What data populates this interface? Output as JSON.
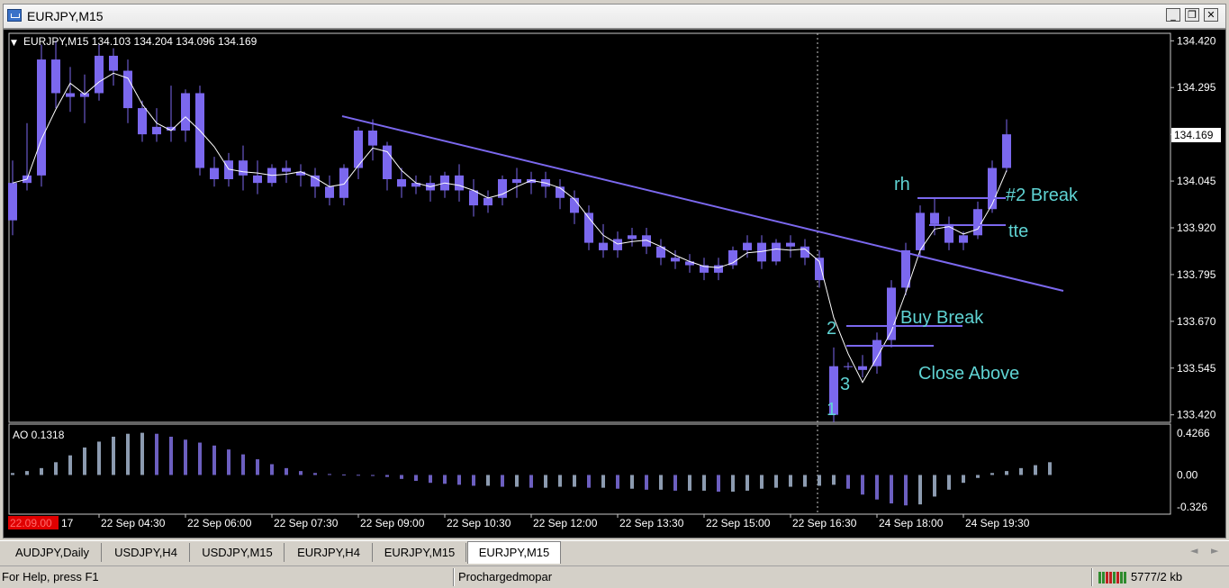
{
  "window": {
    "title": "EURJPY,M15",
    "minimize_glyph": "_",
    "restore_glyph": "❐",
    "close_glyph": "✕"
  },
  "chart": {
    "header_arrow": "▼",
    "header_text": "EURJPY,M15  134.103 134.204 134.096 134.169",
    "indicator_label": "AO 0.1318",
    "current_price_label": "134.169",
    "red_time_label": "22.09.00",
    "first_time_tail": "17",
    "annotations": {
      "rh": "rh",
      "break2": "#2 Break",
      "tte": "tte",
      "buy_break": "Buy Break",
      "close_above": "Close Above",
      "n1": "1",
      "n2": "2",
      "n3": "3"
    },
    "colors": {
      "background": "#000000",
      "candle": "#7b68ee",
      "trend": "#7b68ee",
      "ma": "#ffffff",
      "annotation": "#5fd3d3",
      "axis_text": "#c0c0c0",
      "ao_up": "#8c9bb0",
      "ao_down": "#6c5fc0"
    }
  },
  "chart_data": {
    "type": "candlestick",
    "symbol": "EURJPY",
    "timeframe": "M15",
    "price_ticks": [
      "134.420",
      "134.295",
      "134.170",
      "134.045",
      "133.920",
      "133.795",
      "133.670",
      "133.545",
      "133.420"
    ],
    "price_tick_values": [
      134.42,
      134.295,
      134.17,
      134.045,
      133.92,
      133.795,
      133.67,
      133.545,
      133.42
    ],
    "ylim": [
      133.4,
      134.44
    ],
    "ao_ticks": [
      "0.4266",
      "0.00",
      "-0.326"
    ],
    "ao_tick_values": [
      0.4266,
      0.0,
      -0.326
    ],
    "time_ticks": [
      "22 Sep 04:30",
      "22 Sep 06:00",
      "22 Sep 07:30",
      "22 Sep 09:00",
      "22 Sep 10:30",
      "22 Sep 12:00",
      "22 Sep 13:30",
      "22 Sep 15:00",
      "22 Sep 16:30",
      "24 Sep 18:00",
      "24 Sep 19:30"
    ],
    "last_close": 134.169,
    "candles": [
      {
        "o": 133.94,
        "h": 134.1,
        "c": 134.04,
        "l": 133.9
      },
      {
        "o": 134.04,
        "h": 134.2,
        "c": 134.06,
        "l": 134.02
      },
      {
        "o": 134.06,
        "h": 134.41,
        "c": 134.37,
        "l": 134.03
      },
      {
        "o": 134.37,
        "h": 134.42,
        "c": 134.28,
        "l": 134.24
      },
      {
        "o": 134.28,
        "h": 134.35,
        "c": 134.27,
        "l": 134.23
      },
      {
        "o": 134.27,
        "h": 134.33,
        "c": 134.28,
        "l": 134.2
      },
      {
        "o": 134.28,
        "h": 134.41,
        "c": 134.38,
        "l": 134.26
      },
      {
        "o": 134.38,
        "h": 134.4,
        "c": 134.34,
        "l": 134.3
      },
      {
        "o": 134.34,
        "h": 134.37,
        "c": 134.24,
        "l": 134.2
      },
      {
        "o": 134.24,
        "h": 134.26,
        "c": 134.17,
        "l": 134.15
      },
      {
        "o": 134.17,
        "h": 134.24,
        "c": 134.19,
        "l": 134.15
      },
      {
        "o": 134.19,
        "h": 134.3,
        "c": 134.18,
        "l": 134.15
      },
      {
        "o": 134.18,
        "h": 134.29,
        "c": 134.28,
        "l": 134.15
      },
      {
        "o": 134.28,
        "h": 134.3,
        "c": 134.08,
        "l": 134.06
      },
      {
        "o": 134.08,
        "h": 134.11,
        "c": 134.05,
        "l": 134.03
      },
      {
        "o": 134.05,
        "h": 134.12,
        "c": 134.1,
        "l": 134.03
      },
      {
        "o": 134.1,
        "h": 134.14,
        "c": 134.06,
        "l": 134.02
      },
      {
        "o": 134.06,
        "h": 134.1,
        "c": 134.04,
        "l": 134.01
      },
      {
        "o": 134.04,
        "h": 134.09,
        "c": 134.08,
        "l": 134.03
      },
      {
        "o": 134.08,
        "h": 134.1,
        "c": 134.07,
        "l": 134.04
      },
      {
        "o": 134.07,
        "h": 134.09,
        "c": 134.06,
        "l": 134.03
      },
      {
        "o": 134.06,
        "h": 134.08,
        "c": 134.03,
        "l": 134.0
      },
      {
        "o": 134.03,
        "h": 134.06,
        "c": 134.0,
        "l": 133.98
      },
      {
        "o": 134.0,
        "h": 134.09,
        "c": 134.08,
        "l": 133.98
      },
      {
        "o": 134.08,
        "h": 134.19,
        "c": 134.18,
        "l": 134.05
      },
      {
        "o": 134.18,
        "h": 134.21,
        "c": 134.14,
        "l": 134.1
      },
      {
        "o": 134.14,
        "h": 134.15,
        "c": 134.05,
        "l": 134.02
      },
      {
        "o": 134.05,
        "h": 134.08,
        "c": 134.03,
        "l": 134.0
      },
      {
        "o": 134.03,
        "h": 134.06,
        "c": 134.04,
        "l": 134.01
      },
      {
        "o": 134.04,
        "h": 134.06,
        "c": 134.02,
        "l": 133.99
      },
      {
        "o": 134.02,
        "h": 134.07,
        "c": 134.06,
        "l": 134.0
      },
      {
        "o": 134.06,
        "h": 134.09,
        "c": 134.02,
        "l": 133.99
      },
      {
        "o": 134.02,
        "h": 134.05,
        "c": 133.98,
        "l": 133.95
      },
      {
        "o": 133.98,
        "h": 134.02,
        "c": 134.0,
        "l": 133.96
      },
      {
        "o": 134.0,
        "h": 134.06,
        "c": 134.05,
        "l": 133.98
      },
      {
        "o": 134.05,
        "h": 134.08,
        "c": 134.04,
        "l": 134.0
      },
      {
        "o": 134.04,
        "h": 134.07,
        "c": 134.05,
        "l": 134.01
      },
      {
        "o": 134.05,
        "h": 134.07,
        "c": 134.03,
        "l": 134.0
      },
      {
        "o": 134.03,
        "h": 134.05,
        "c": 134.0,
        "l": 133.97
      },
      {
        "o": 134.0,
        "h": 134.02,
        "c": 133.96,
        "l": 133.93
      },
      {
        "o": 133.96,
        "h": 133.98,
        "c": 133.88,
        "l": 133.86
      },
      {
        "o": 133.88,
        "h": 133.93,
        "c": 133.86,
        "l": 133.84
      },
      {
        "o": 133.86,
        "h": 133.91,
        "c": 133.89,
        "l": 133.84
      },
      {
        "o": 133.89,
        "h": 133.92,
        "c": 133.9,
        "l": 133.87
      },
      {
        "o": 133.9,
        "h": 133.92,
        "c": 133.87,
        "l": 133.85
      },
      {
        "o": 133.87,
        "h": 133.89,
        "c": 133.84,
        "l": 133.82
      },
      {
        "o": 133.84,
        "h": 133.86,
        "c": 133.83,
        "l": 133.81
      },
      {
        "o": 133.83,
        "h": 133.85,
        "c": 133.82,
        "l": 133.8
      },
      {
        "o": 133.82,
        "h": 133.84,
        "c": 133.8,
        "l": 133.78
      },
      {
        "o": 133.8,
        "h": 133.84,
        "c": 133.82,
        "l": 133.78
      },
      {
        "o": 133.82,
        "h": 133.87,
        "c": 133.86,
        "l": 133.81
      },
      {
        "o": 133.86,
        "h": 133.9,
        "c": 133.88,
        "l": 133.84
      },
      {
        "o": 133.88,
        "h": 133.9,
        "c": 133.83,
        "l": 133.81
      },
      {
        "o": 133.83,
        "h": 133.89,
        "c": 133.88,
        "l": 133.82
      },
      {
        "o": 133.88,
        "h": 133.9,
        "c": 133.87,
        "l": 133.84
      },
      {
        "o": 133.87,
        "h": 133.89,
        "c": 133.84,
        "l": 133.82
      },
      {
        "o": 133.84,
        "h": 133.86,
        "c": 133.78,
        "l": 133.76
      },
      {
        "o": 133.55,
        "h": 133.6,
        "c": 133.42,
        "l": 133.4
      },
      {
        "o": 133.55,
        "h": 133.56,
        "c": 133.55,
        "l": 133.54
      },
      {
        "o": 133.54,
        "h": 133.58,
        "c": 133.55,
        "l": 133.52
      },
      {
        "o": 133.55,
        "h": 133.64,
        "c": 133.62,
        "l": 133.53
      },
      {
        "o": 133.62,
        "h": 133.78,
        "c": 133.76,
        "l": 133.6
      },
      {
        "o": 133.76,
        "h": 133.88,
        "c": 133.86,
        "l": 133.74
      },
      {
        "o": 133.86,
        "h": 133.98,
        "c": 133.96,
        "l": 133.84
      },
      {
        "o": 133.96,
        "h": 134.0,
        "c": 133.93,
        "l": 133.9
      },
      {
        "o": 133.93,
        "h": 133.95,
        "c": 133.88,
        "l": 133.86
      },
      {
        "o": 133.88,
        "h": 133.91,
        "c": 133.9,
        "l": 133.86
      },
      {
        "o": 133.9,
        "h": 133.99,
        "c": 133.97,
        "l": 133.89
      },
      {
        "o": 133.97,
        "h": 134.1,
        "c": 134.08,
        "l": 133.96
      },
      {
        "o": 134.08,
        "h": 134.21,
        "c": 134.17,
        "l": 134.07
      }
    ],
    "ao_values": [
      0.02,
      0.04,
      0.07,
      0.13,
      0.2,
      0.28,
      0.34,
      0.39,
      0.42,
      0.43,
      0.42,
      0.39,
      0.36,
      0.33,
      0.3,
      0.26,
      0.21,
      0.16,
      0.11,
      0.07,
      0.04,
      0.02,
      0.01,
      0.005,
      0.002,
      -0.01,
      -0.02,
      -0.04,
      -0.06,
      -0.08,
      -0.09,
      -0.1,
      -0.11,
      -0.11,
      -0.12,
      -0.12,
      -0.13,
      -0.13,
      -0.12,
      -0.12,
      -0.13,
      -0.13,
      -0.14,
      -0.14,
      -0.15,
      -0.15,
      -0.16,
      -0.16,
      -0.16,
      -0.17,
      -0.17,
      -0.16,
      -0.14,
      -0.13,
      -0.12,
      -0.12,
      -0.11,
      -0.1,
      -0.14,
      -0.2,
      -0.25,
      -0.29,
      -0.31,
      -0.3,
      -0.22,
      -0.15,
      -0.08,
      -0.03,
      0.02,
      0.04,
      0.07,
      0.1,
      0.13
    ]
  },
  "tabs": [
    {
      "label": "AUDJPY,Daily",
      "active": false
    },
    {
      "label": "USDJPY,H4",
      "active": false
    },
    {
      "label": "USDJPY,M15",
      "active": false
    },
    {
      "label": "EURJPY,H4",
      "active": false
    },
    {
      "label": "EURJPY,M15",
      "active": false
    },
    {
      "label": "EURJPY,M15",
      "active": true
    }
  ],
  "tab_scroll": {
    "left": "◄",
    "right": "►"
  },
  "status": {
    "help": "For Help, press F1",
    "profile": "Prochargedmopar",
    "traffic": "5777/2 kb"
  }
}
